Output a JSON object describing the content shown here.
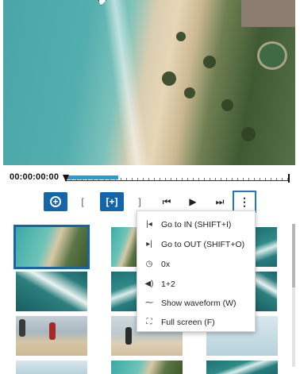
{
  "player": {
    "timecode": "00:00:00:00",
    "progress": 0.23
  },
  "controls": {
    "add": "+",
    "in_bracket": "[",
    "mark_range": "[+]",
    "out_bracket": "]",
    "prev": "⏮",
    "play": "▶",
    "next": "⏭",
    "more": "⋮"
  },
  "menu": {
    "items": [
      {
        "icon": "go-to-in-icon",
        "glyph": "|◂",
        "label": "Go to IN (SHIFT+I)"
      },
      {
        "icon": "go-to-out-icon",
        "glyph": "▸|",
        "label": "Go to OUT (SHIFT+O)"
      },
      {
        "icon": "speed-icon",
        "glyph": "◷",
        "label": "0x"
      },
      {
        "icon": "volume-icon",
        "glyph": "◀)",
        "label": "1+2"
      },
      {
        "icon": "waveform-icon",
        "glyph": "⁓",
        "label": "Show waveform (W)"
      },
      {
        "icon": "fullscreen-icon",
        "glyph": "⛶",
        "label": "Full screen (F)"
      }
    ]
  },
  "colors": {
    "accent": "#1565a9",
    "progress": "#2a9bd4",
    "focus_border": "#1e78c8"
  }
}
